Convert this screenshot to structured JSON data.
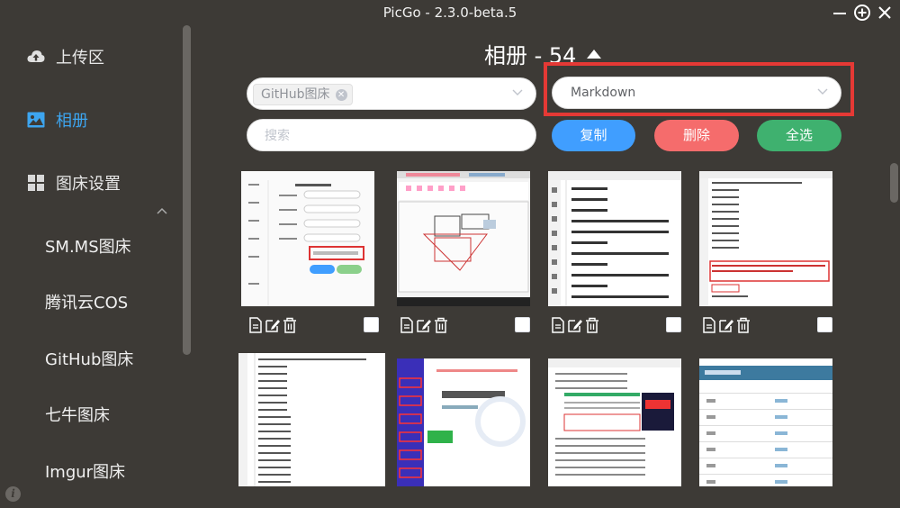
{
  "window": {
    "title": "PicGo - 2.3.0-beta.5"
  },
  "sidebar": {
    "items": [
      {
        "label": "上传区",
        "icon": "cloud-upload-icon"
      },
      {
        "label": "相册",
        "icon": "image-icon",
        "active": true
      },
      {
        "label": "图床设置",
        "icon": "grid-icon",
        "expanded": true
      }
    ],
    "sub_items": [
      "SM.MS图床",
      "腾讯云COS",
      "GitHub图床",
      "七牛图床",
      "Imgur图床"
    ]
  },
  "gallery": {
    "title": "相册 - 54",
    "host_filter": {
      "tag": "GitHub图床"
    },
    "format_select": {
      "value": "Markdown"
    },
    "search": {
      "placeholder": "搜索"
    },
    "buttons": {
      "copy": "复制",
      "delete": "删除",
      "select_all": "全选"
    }
  },
  "colors": {
    "accent": "#409eff",
    "danger": "#f56c6c",
    "success": "#3fb16f",
    "background": "#3d3a36",
    "highlight": "#e53935"
  }
}
